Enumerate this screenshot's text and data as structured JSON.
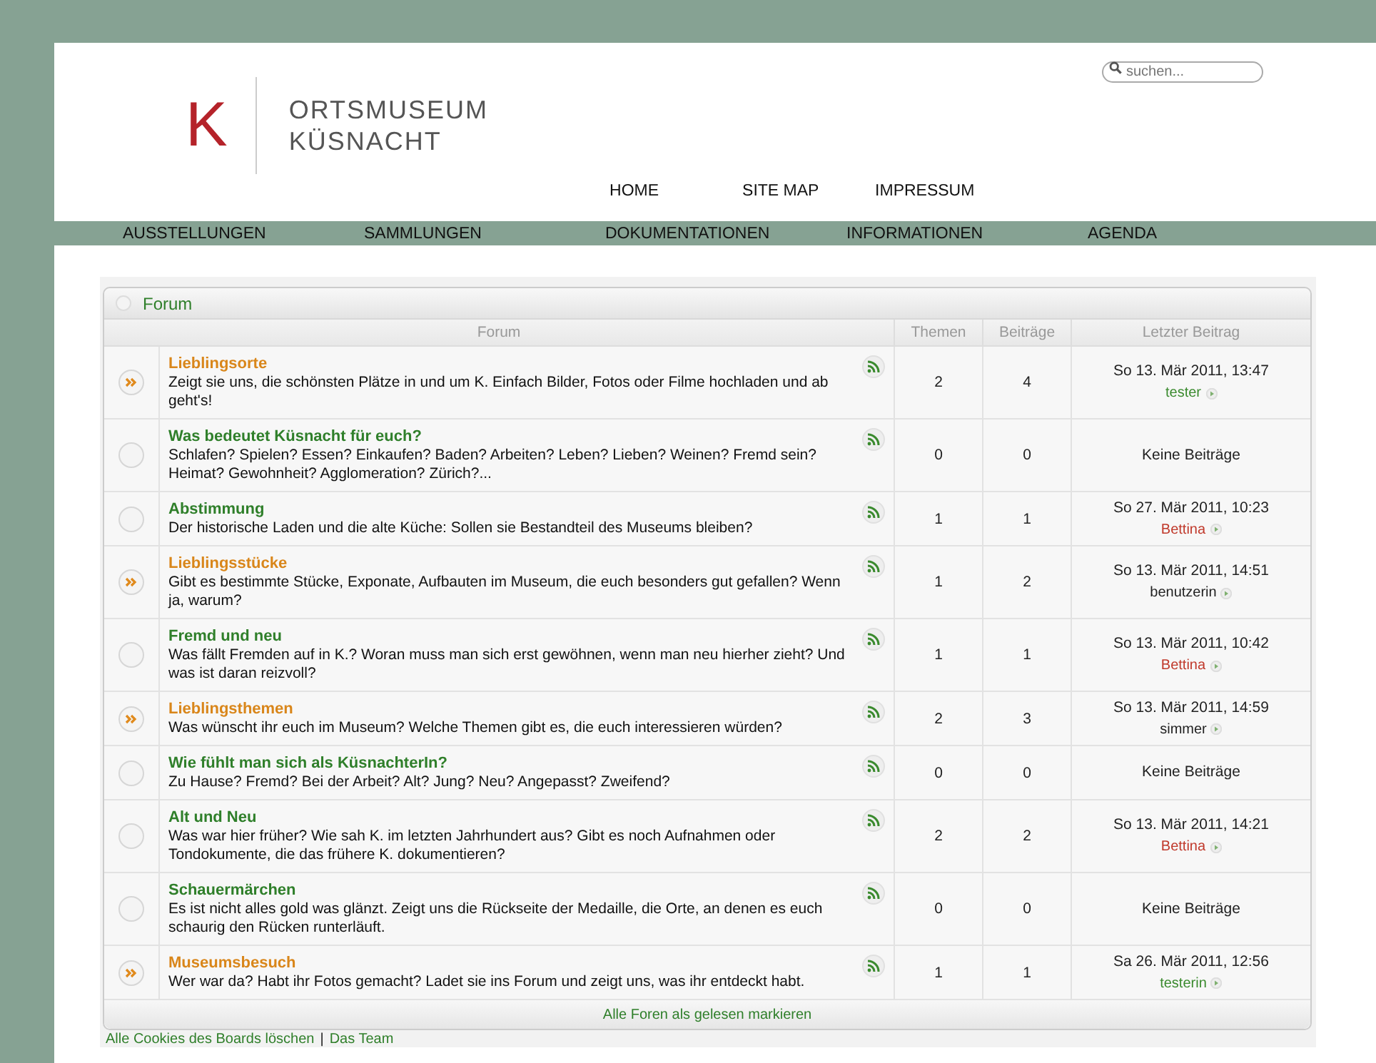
{
  "header": {
    "logo_letter": "K",
    "site_title": [
      "ORTSMUSEUM",
      "KÜSNACHT"
    ],
    "search": {
      "placeholder": "suchen..."
    },
    "top_links": [
      "HOME",
      "SITE MAP",
      "IMPRESSUM"
    ]
  },
  "main_nav": [
    "AUSSTELLUNGEN",
    "SAMMLUNGEN",
    "DOKUMENTATIONEN",
    "INFORMATIONEN",
    "AGENDA"
  ],
  "forum_box": {
    "title": "Forum",
    "columns": [
      "Forum",
      "Themen",
      "Beiträge",
      "Letzter Beitrag"
    ],
    "forums": [
      {
        "title": "Lieblingsorte",
        "unread": true,
        "description": "Zeigt sie uns, die schönsten Plätze in und um K. Einfach Bilder, Fotos oder Filme hochladen und ab geht's!",
        "topics": "2",
        "posts": "4",
        "last_post": {
          "date": "So 13. Mär 2011, 13:47",
          "author": "tester",
          "color": "#3a8a2e"
        }
      },
      {
        "title": "Was bedeutet Küsnacht für euch?",
        "unread": false,
        "description": "Schlafen? Spielen? Essen? Einkaufen? Baden? Arbeiten? Leben? Lieben? Weinen? Fremd sein? Heimat? Gewohnheit? Agglomeration? Zürich?...",
        "topics": "0",
        "posts": "0",
        "last_post": {
          "empty": "Keine Beiträge"
        }
      },
      {
        "title": "Abstimmung",
        "unread": false,
        "description": "Der historische Laden und die alte Küche: Sollen sie Bestandteil des Museums bleiben?",
        "topics": "1",
        "posts": "1",
        "last_post": {
          "date": "So 27. Mär 2011, 10:23",
          "author": "Bettina",
          "color": "#c0392b"
        }
      },
      {
        "title": "Lieblingsstücke",
        "unread": true,
        "description": "Gibt es bestimmte Stücke, Exponate, Aufbauten im Museum, die euch besonders gut gefallen? Wenn ja, warum?",
        "topics": "1",
        "posts": "2",
        "last_post": {
          "date": "So 13. Mär 2011, 14:51",
          "author": "benutzerin",
          "color": "#222222"
        }
      },
      {
        "title": "Fremd und neu",
        "unread": false,
        "description": "Was fällt Fremden auf in K.? Woran muss man sich erst gewöhnen, wenn man neu hierher zieht? Und was ist daran reizvoll?",
        "topics": "1",
        "posts": "1",
        "last_post": {
          "date": "So 13. Mär 2011, 10:42",
          "author": "Bettina",
          "color": "#c0392b"
        }
      },
      {
        "title": "Lieblingsthemen",
        "unread": true,
        "description": "Was wünscht ihr euch im Museum? Welche Themen gibt es, die euch interessieren würden?",
        "topics": "2",
        "posts": "3",
        "last_post": {
          "date": "So 13. Mär 2011, 14:59",
          "author": "simmer",
          "color": "#222222"
        }
      },
      {
        "title": "Wie fühlt man sich als KüsnachterIn?",
        "unread": false,
        "description": "Zu Hause? Fremd? Bei der Arbeit? Alt? Jung? Neu? Angepasst? Zweifend?",
        "topics": "0",
        "posts": "0",
        "last_post": {
          "empty": "Keine Beiträge"
        }
      },
      {
        "title": "Alt und Neu",
        "unread": false,
        "description": "Was war hier früher? Wie sah K. im letzten Jahrhundert aus? Gibt es noch Aufnahmen oder Tondokumente, die das frühere K. dokumentieren?",
        "topics": "2",
        "posts": "2",
        "last_post": {
          "date": "So 13. Mär 2011, 14:21",
          "author": "Bettina",
          "color": "#c0392b"
        }
      },
      {
        "title": "Schauermärchen",
        "unread": false,
        "description": "Es ist nicht alles gold was glänzt. Zeigt uns die Rückseite der Medaille, die Orte, an denen es euch schaurig den Rücken runterläuft.",
        "topics": "0",
        "posts": "0",
        "last_post": {
          "empty": "Keine Beiträge"
        }
      },
      {
        "title": "Museumsbesuch",
        "unread": true,
        "description": "Wer war da? Habt ihr Fotos gemacht? Ladet sie ins Forum und zeigt uns, was ihr entdeckt habt.",
        "topics": "1",
        "posts": "1",
        "last_post": {
          "date": "Sa 26. Mär 2011, 12:56",
          "author": "testerin",
          "color": "#3a8a2e"
        }
      }
    ],
    "mark_read": "Alle Foren als gelesen markieren"
  },
  "footer_links": [
    "Alle Cookies des Boards löschen",
    "|",
    "Das Team"
  ]
}
